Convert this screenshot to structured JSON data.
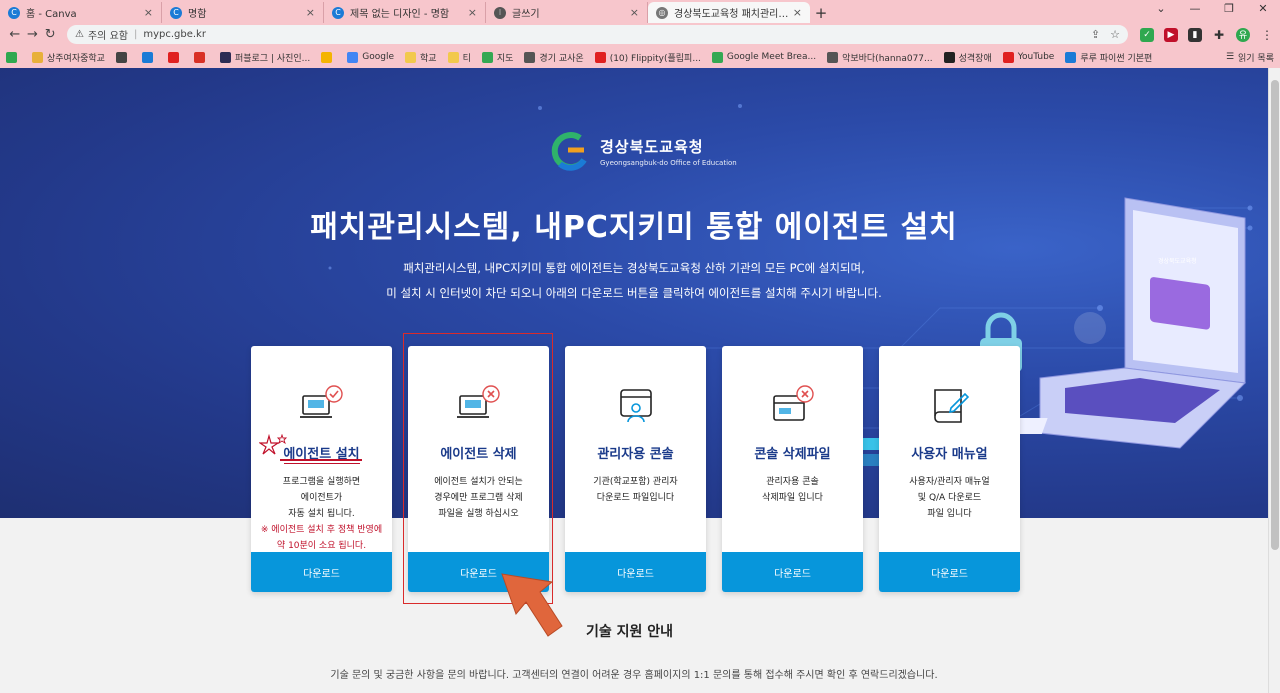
{
  "browser": {
    "tabs": [
      {
        "label": "홈 - Canva",
        "color": "#1b7bd6",
        "glyph": "C"
      },
      {
        "label": "명함",
        "color": "#1b7bd6",
        "glyph": "C"
      },
      {
        "label": "제목 없는 디자인 - 명함",
        "color": "#1b7bd6",
        "glyph": "C"
      },
      {
        "label": "글쓰기",
        "color": "#555555",
        "glyph": "⁝"
      },
      {
        "label": "경상북도교육청 패치관리시스템",
        "color": "#777777",
        "glyph": "◎"
      }
    ],
    "address": {
      "warning": "주의 요함",
      "url": "mypc.gbe.kr"
    },
    "bookmarks": [
      {
        "label": "",
        "color": "#2fa84f"
      },
      {
        "label": "상주여자중학교",
        "color": "#e8b03a"
      },
      {
        "label": "",
        "color": "#444444"
      },
      {
        "label": "",
        "color": "#1b7bd6"
      },
      {
        "label": "",
        "color": "#e02020"
      },
      {
        "label": "",
        "color": "#d93025"
      },
      {
        "label": "퍼블로그 | 사진인...",
        "color": "#2c2c54"
      },
      {
        "label": "",
        "color": "#f4b400"
      },
      {
        "label": "Google",
        "color": "#4285f4"
      },
      {
        "label": "학교",
        "color": "#f2c94c"
      },
      {
        "label": "티",
        "color": "#f2c94c"
      },
      {
        "label": "지도",
        "color": "#34a853"
      },
      {
        "label": "경기 교사온",
        "color": "#555555"
      },
      {
        "label": "(10) Flippity(플립피...",
        "color": "#e02020"
      },
      {
        "label": "Google Meet Brea...",
        "color": "#34a853"
      },
      {
        "label": "악보바다(hanna077...",
        "color": "#555555"
      },
      {
        "label": "성격장애",
        "color": "#222222"
      },
      {
        "label": "YouTube",
        "color": "#e02020"
      },
      {
        "label": "루루 파이썬 기본편",
        "color": "#1b7bd6"
      }
    ],
    "reading_list": "읽기 목록"
  },
  "page": {
    "logo_korean": "경상북도교육청",
    "logo_english": "Gyeongsangbuk-do Office of Education",
    "laptop_screen_text": "경상북도교육청",
    "title": "패치관리시스템, 내PC지키미 통합 에이전트 설치",
    "desc_line1": "패치관리시스템, 내PC지키미 통합 에이전트는 경상북도교육청 산하 기관의 모든 PC에 설치되며,",
    "desc_line2": "미 설치 시 인터넷이 차단 되오니 아래의 다운로드 버튼을 클릭하여 에이전트를 설치해 주시기 바랍니다.",
    "cards": [
      {
        "title": "에이전트 설치",
        "lines": [
          "프로그램을 실행하면",
          "에이전트가",
          "자동 설치 됩니다."
        ],
        "warn": [
          "※ 에이전트 설치 후 정책 반영에",
          "약 10분이 소요 됩니다."
        ],
        "button": "다운로드",
        "icon": "laptop-check-icon"
      },
      {
        "title": "에이전트 삭제",
        "lines": [
          "에이전트 설치가 안되는",
          "경우에만 프로그램 삭제",
          "파일을 실행 하십시오"
        ],
        "warn": [],
        "button": "다운로드",
        "icon": "laptop-x-icon"
      },
      {
        "title": "관리자용 콘솔",
        "lines": [
          "기관(학교포함) 관리자",
          "다운로드 파일입니다"
        ],
        "warn": [],
        "button": "다운로드",
        "icon": "admin-console-icon"
      },
      {
        "title": "콘솔 삭제파일",
        "lines": [
          "관리자용 콘솔",
          "삭제파일 입니다"
        ],
        "warn": [],
        "button": "다운로드",
        "icon": "console-delete-icon"
      },
      {
        "title": "사용자 매뉴얼",
        "lines": [
          "사용자/관리자 매뉴얼",
          "및 Q/A 다운로드",
          "파일 입니다"
        ],
        "warn": [],
        "button": "다운로드",
        "icon": "manual-book-icon"
      }
    ],
    "support_title": "기술 지원 안내",
    "footer": "기술 문의 및 궁금한 사항을 문의 바랍니다. 고객센터의 연결이 어려운 경우 홈페이지의 1:1 문의를 통해 접수해 주시면 확인 후 연락드리겠습니다."
  },
  "colors": {
    "accent": "#0796db",
    "hero": "#2b4aa8",
    "card_title": "#1a3a8a",
    "warn": "#c0102a",
    "annotation": "#d92b2b",
    "arrow": "#e0663c"
  }
}
